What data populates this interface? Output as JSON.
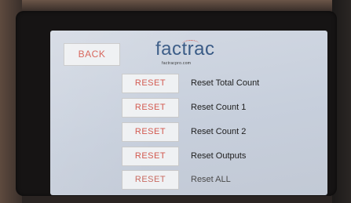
{
  "header": {
    "back_label": "BACK",
    "logo_text": "factrac",
    "logo_url": "factracpro.com"
  },
  "reset_items": [
    {
      "button_label": "RESET",
      "label": "Reset Total Count"
    },
    {
      "button_label": "RESET",
      "label": "Reset Count 1"
    },
    {
      "button_label": "RESET",
      "label": "Reset Count 2"
    },
    {
      "button_label": "RESET",
      "label": "Reset Outputs"
    },
    {
      "button_label": "RESET",
      "label": "Reset ALL"
    }
  ],
  "colors": {
    "screen_background": "#cdd4df",
    "button_text": "#d2574d",
    "logo_text": "#3a5b86"
  }
}
